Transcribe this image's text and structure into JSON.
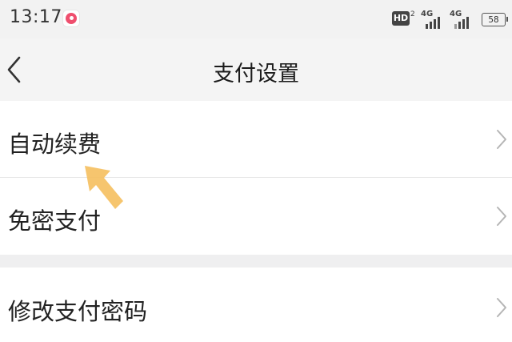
{
  "status_bar": {
    "time": "13:17",
    "hd_label": "HD",
    "hd_sub": "2",
    "network1": "4G",
    "network2": "4G",
    "battery": "58",
    "app_icon": "app-notification-icon"
  },
  "header": {
    "title": "支付设置",
    "back_icon": "chevron-left-icon"
  },
  "settings": {
    "group1": [
      {
        "label": "自动续费",
        "icon": "chevron-right-icon"
      },
      {
        "label": "免密支付",
        "icon": "chevron-right-icon"
      }
    ],
    "group2": [
      {
        "label": "修改支付密码",
        "icon": "chevron-right-icon"
      }
    ]
  },
  "annotation": {
    "icon": "pointer-arrow-icon",
    "color": "#f5c062"
  },
  "colors": {
    "background": "#efeff0",
    "card": "#ffffff",
    "divider": "#e6e6e6",
    "chevron": "#b5b5b5"
  }
}
